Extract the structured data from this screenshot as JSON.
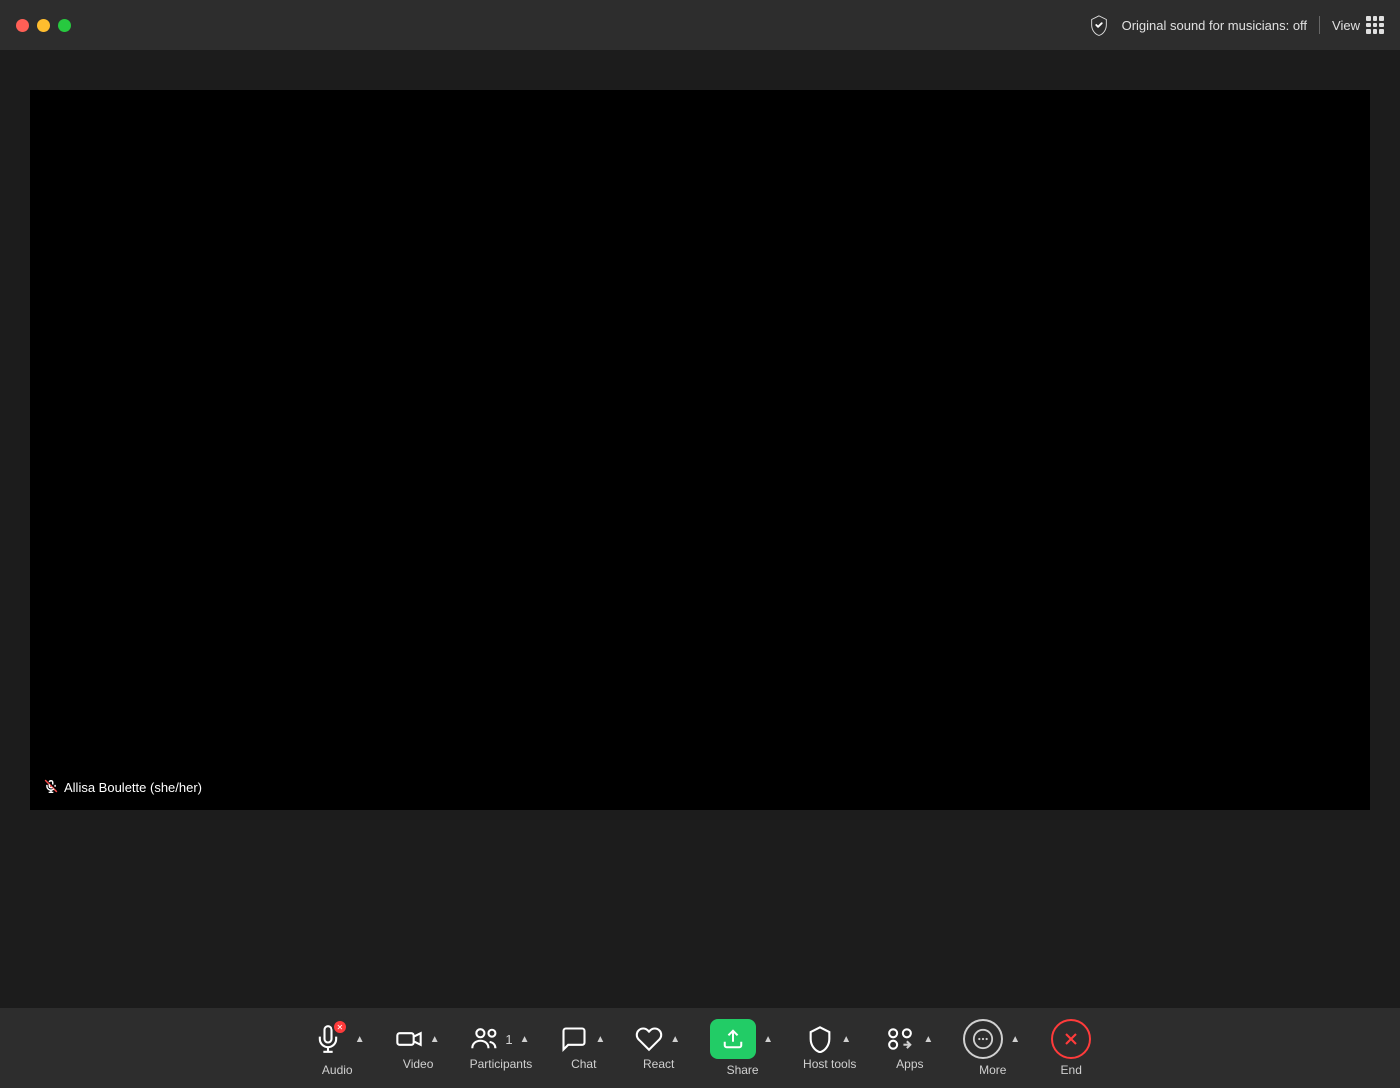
{
  "window": {
    "traffic_lights": {
      "close_label": "close",
      "minimize_label": "minimize",
      "maximize_label": "maximize"
    }
  },
  "header": {
    "sound_label": "Original sound for musicians: off",
    "view_label": "View",
    "shield_color": "#22cc55"
  },
  "video": {
    "participant_name": "Allisa Boulette (she/her)",
    "background_color": "#000000"
  },
  "toolbar": {
    "audio_label": "Audio",
    "video_label": "Video",
    "participants_label": "Participants",
    "participants_count": "1",
    "chat_label": "Chat",
    "react_label": "React",
    "share_label": "Share",
    "host_tools_label": "Host tools",
    "apps_label": "Apps",
    "more_label": "More",
    "end_label": "End"
  }
}
